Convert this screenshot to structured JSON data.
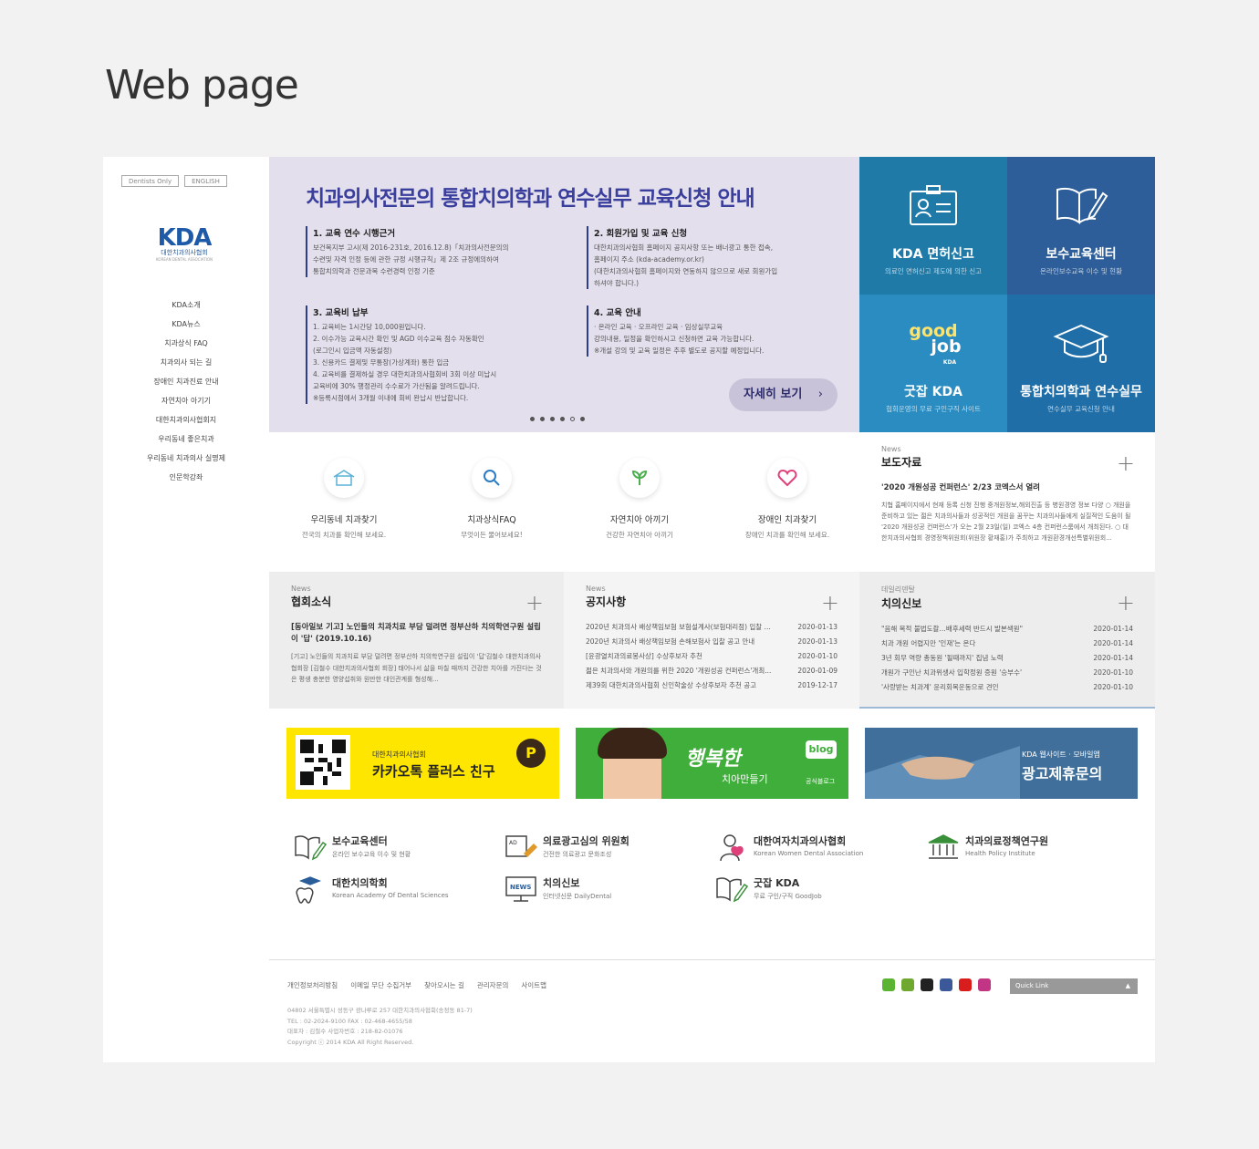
{
  "heading": "Web page",
  "sidebar": {
    "lang": [
      "Dentists Only",
      "ENGLISH"
    ],
    "logo": {
      "text": "KDA",
      "kr": "대한치과의사협회",
      "en": "KOREAN DENTAL ASSOCIATION"
    },
    "menu": [
      "KDA소개",
      "KDA뉴스",
      "치과상식 FAQ",
      "치과의사 되는 길",
      "장애인 치과진료 안내",
      "자연치아 아기기",
      "대한치과의사협회지",
      "우리동네 좋은치과",
      "우리동네 치과의사 실명제",
      "인문학강좌"
    ]
  },
  "banner": {
    "title": "치과의사전문의 통합치의학과 연수실무 교육신청 안내",
    "sections": [
      {
        "h": "1. 교육 연수 시행근거",
        "t": "보건복지부 고시(제 2016-231호, 2016.12.8)「치과의사전문의의\n수련및 자격 인정 등에 관한 규정 시행규칙」제 2조 규정에의하여\n통합치의학과 전문과목 수련경력 인정 기준"
      },
      {
        "h": "2. 회원가입 및 교육 신청",
        "t": "대한치과의사협회 홈페이지 공지사항 또는 배너광고 통한 접속,\n홈페이지 주소 (kda-academy.or.kr)\n(대한치과의사협회 홈페이지와 연동하지 않으므로 새로 회원가입\n하셔야 합니다.)"
      },
      {
        "h": "3. 교육비 납부",
        "t": "1. 교육비는 1시간당 10,000원입니다.\n2. 이수가능 교육시간 확인 및 AGD 이수교육 점수 자동확인\n    (로그인시 입금액 자동설정)\n3. 신용카드 결제및 무통장(가상계좌) 통한 입금\n4. 교육비를 결제하실 경우 대한치과의사협회비 3회 이상 미납시\n    교육비에 30% 행정관리 수수료가 가산됨을 알려드립니다.\n※등록시점에서 3개월 이내에 회비 완납시 반납합니다."
      },
      {
        "h": "4. 교육 안내",
        "t": "· 온라인 교육    · 오프라인 교육     · 임상실무교육\n강의내용, 일정을 확인하시고 신청하면 교육 가능합니다.\n※개설 강의 및 교육 일정은 추후 별도로 공지할 예정입니다."
      }
    ],
    "button": "자세히 보기",
    "arrow": "›"
  },
  "tiles": [
    {
      "title": "KDA 면허신고",
      "sub": "의료인 면허신고 제도에 의한 신고",
      "color": "#1f7aa8"
    },
    {
      "title": "보수교육센터",
      "sub": "온라인보수교육 이수 및 현황",
      "color": "#2d5e99"
    },
    {
      "title": "굿잡 KDA",
      "sub": "협회운영의 무료 구인구직 사이트",
      "color": "#2a8cc0"
    },
    {
      "title": "통합치의학과 연수실무",
      "sub": "연수실무 교육신청 안내",
      "color": "#1f6ea8"
    }
  ],
  "tile_logo": {
    "good": "good",
    "job": "job",
    "kda": "KDA"
  },
  "quick": [
    {
      "title": "우리동네 치과찾기",
      "sub": "전국의 치과를 확인해 보세요."
    },
    {
      "title": "치과상식FAQ",
      "sub": "무엇이든 물어보세요!"
    },
    {
      "title": "자연치아 아끼기",
      "sub": "건강한 자연치아 아끼기"
    },
    {
      "title": "장애인 치과찾기",
      "sub": "장애인 치과를 확인해 보세요."
    }
  ],
  "press": {
    "label": "News",
    "title": "보도자료",
    "head": "'2020 개원성공 컨퍼런스' 2/23 코엑스서 열려",
    "body": "치협 홈페이지에서 현재 등록 신청 진행 중개원정보,해외진출 등 병원경영 정보 다양 ○ 개원을 준비하고 있는 젊은 치과의사들과 성공적인 개원을 꿈꾸는 치과의사들에게 실질적인 도움이 될 '2020 개원성공 컨퍼런스'가 오는 2월 23일(일) 코엑스 4층 컨퍼런스룸에서 개최된다. ○ 대한치과의사협회 경영정책위원회(위원장 황재홍)가 주최하고 개원환경개선특별위원회..."
  },
  "assoc": {
    "label": "News",
    "title": "협회소식",
    "head": "[동아일보 기고] 노인들의 치과치료 부담 덜려면 정부산하 치의학연구원 설립이 '답' (2019.10.16)",
    "body": "[기고] 노인들의 치과치료 부담 덜려면 정부산하 치의학연구원 설립이 '답'김철수 대한치과의사협회장 [김철수 대한치과의사협회 회장] 태어나서 삶을 마칠 때까지 건강한 치아를 가진다는 것은 평생 충분한 영양섭취와 원만한 대인관계를 형성해..."
  },
  "notice": {
    "label": "News",
    "title": "공지사항",
    "rows": [
      [
        "2020년 치과의사 배상책임보험 보험설계사(보험대리점) 입찰 ...",
        "2020-01-13"
      ],
      [
        "2020년 치과의사 배상책임보험 손해보험사 입찰 공고 안내",
        "2020-01-13"
      ],
      [
        "[윤광열치과의료봉사상] 수상후보자 추천",
        "2020-01-10"
      ],
      [
        "젊은 치과의사와 개원의를 위한 2020 '개원성공 컨퍼런스'개최...",
        "2020-01-09"
      ],
      [
        "제39회 대한치과의사협회 신인학술상 수상후보자 추천 공고",
        "2019-12-17"
      ]
    ]
  },
  "daily": {
    "label": "데일리덴탈",
    "title": "치의신보",
    "rows": [
      [
        "\"음해 목적 불법도촬…배후세력 반드시 발본색원\"",
        "2020-01-14"
      ],
      [
        "치과 개원 어렵지만 '인재'는 온다",
        "2020-01-14"
      ],
      [
        "3년 회무 역량 총동원 '될때까지' 집념 노력",
        "2020-01-14"
      ],
      [
        "개원가 구인난 치과위생사 입학정원 증원 '승부수'",
        "2020-01-10"
      ],
      [
        "'사랑받는 치과계' 윤리회복운동으로 견인",
        "2020-01-10"
      ]
    ]
  },
  "plus": "+",
  "ads": [
    {
      "sub": "대한치과의사협회",
      "title": "카카오톡 플러스 친구",
      "icon": "P"
    },
    {
      "title": "행복한",
      "sub": "치아만들기",
      "badge": "blog",
      "badge_sub": "공식블로그"
    },
    {
      "sub": "KDA 웹사이트 · 모바일앱",
      "title": "광고제휴문의"
    }
  ],
  "links": [
    {
      "title": "보수교육센터",
      "sub": "온라인 보수교육 이수 및 현황"
    },
    {
      "title": "의료광고심의 위원회",
      "sub": "건전한 의료광고 문화조성",
      "icon_text": "AD"
    },
    {
      "title": "대한여자치과의사협회",
      "sub": "Korean Women Dental Association"
    },
    {
      "title": "치과의료정책연구원",
      "sub": "Health Policy Institute"
    },
    {
      "title": "대한치의학회",
      "sub": "Korean Academy Of Dental Sciences"
    },
    {
      "title": "치의신보",
      "sub": "인터넷신문 DailyDental",
      "icon_text": "NEWS"
    },
    {
      "title": "굿잡 KDA",
      "sub": "무료 구인/구직 GoodJob"
    }
  ],
  "footer": {
    "links": [
      "개인정보처리방침",
      "이메일 무단 수집거부",
      "찾아오시는 길",
      "관리자문의",
      "사이트맵"
    ],
    "address": "04802 서울특별시 성동구 광나루로 257 대한치과의사협회(송정동 81-7)\nTEL : 02-2024-9100 FAX : 02-468-4655/58\n대표자 : 김철수 사업자번호 : 218-82-01076\nCopyright ⓒ 2014 KDA All Right Reserved.",
    "quick_link": "Quick Link",
    "quick_arrow": "▲",
    "social_colors": [
      "#5ab331",
      "#6ea831",
      "#222",
      "#3b5998",
      "#d91c1c",
      "#c13584"
    ]
  }
}
